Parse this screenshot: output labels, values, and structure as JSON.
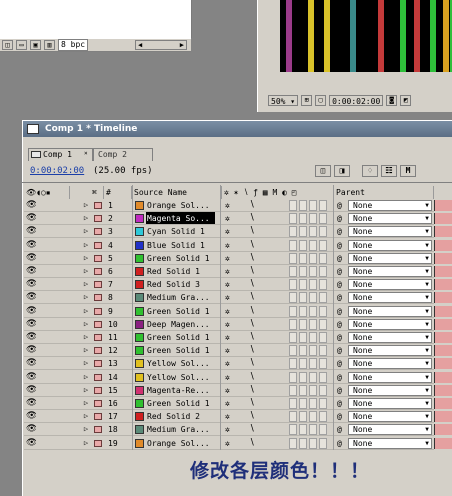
{
  "project_panel": {
    "bpc_label": "8 bpc",
    "toolbar_icons": [
      "flowchart-icon",
      "folder-icon",
      "composition-icon",
      "trash-icon"
    ]
  },
  "viewer": {
    "zoom": "50%",
    "timecode": "0:00:02:00",
    "stripe_colors": [
      "#9b3b8a",
      "#d9c22a",
      "#d9c22a",
      "#3a8a8a",
      "#c43a3a",
      "#2fbf3a",
      "#c43a3a",
      "#2fbf3a",
      "#d9a020",
      "#2fbf3a"
    ]
  },
  "timeline": {
    "window_title": "Comp 1 * Timeline",
    "tabs": [
      {
        "label": "Comp 1"
      },
      {
        "label": "Comp 2"
      }
    ],
    "current_time": "0:00:02:00",
    "fps": "(25.00 fps)",
    "header": {
      "hash": "#",
      "source_name": "Source Name",
      "parent": "Parent"
    },
    "layers": [
      {
        "num": "1",
        "name": "Orange Sol...",
        "color": "#e08a2a",
        "parent": "None"
      },
      {
        "num": "2",
        "name": "Magenta So...",
        "color": "#c02cc0",
        "parent": "None",
        "selected": true
      },
      {
        "num": "3",
        "name": "Cyan Solid 1",
        "color": "#2ec8d8",
        "parent": "None"
      },
      {
        "num": "4",
        "name": "Blue Solid 1",
        "color": "#2030c8",
        "parent": "None"
      },
      {
        "num": "5",
        "name": "Green Solid 1",
        "color": "#30c030",
        "parent": "None"
      },
      {
        "num": "6",
        "name": "Red Solid 1",
        "color": "#d02020",
        "parent": "None"
      },
      {
        "num": "7",
        "name": "Red Solid 3",
        "color": "#d02020",
        "parent": "None"
      },
      {
        "num": "8",
        "name": "Medium Gra...",
        "color": "#5a8a78",
        "parent": "None"
      },
      {
        "num": "9",
        "name": "Green Solid 1",
        "color": "#30c030",
        "parent": "None"
      },
      {
        "num": "10",
        "name": "Deep Magen...",
        "color": "#8a2080",
        "parent": "None"
      },
      {
        "num": "11",
        "name": "Green Solid 1",
        "color": "#30c030",
        "parent": "None"
      },
      {
        "num": "12",
        "name": "Green Solid 1",
        "color": "#30c030",
        "parent": "None"
      },
      {
        "num": "13",
        "name": "Yellow Sol...",
        "color": "#e0c020",
        "parent": "None"
      },
      {
        "num": "14",
        "name": "Yellow Sol...",
        "color": "#e0c020",
        "parent": "None"
      },
      {
        "num": "15",
        "name": "Magenta-Re...",
        "color": "#d03070",
        "parent": "None"
      },
      {
        "num": "16",
        "name": "Green Solid 1",
        "color": "#30c030",
        "parent": "None"
      },
      {
        "num": "17",
        "name": "Red Solid 2",
        "color": "#d02020",
        "parent": "None"
      },
      {
        "num": "18",
        "name": "Medium Gra...",
        "color": "#5a8a78",
        "parent": "None"
      },
      {
        "num": "19",
        "name": "Orange Sol...",
        "color": "#e08a2a",
        "parent": "None"
      }
    ]
  },
  "caption": "修改各层颜色！！！"
}
